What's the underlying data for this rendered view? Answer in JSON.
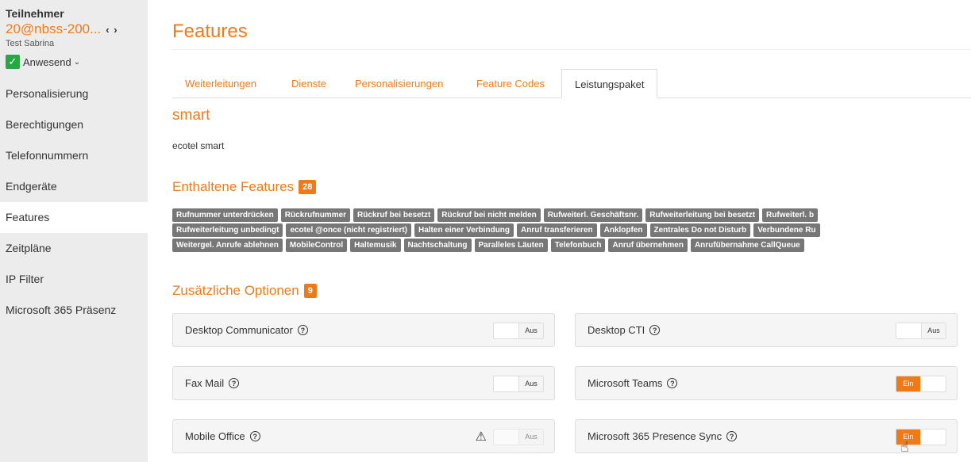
{
  "sidebar": {
    "title": "Teilnehmer",
    "user": "20@nbss-200...",
    "nav_arrows": "‹ ›",
    "subtitle": "Test Sabrina",
    "status": "Anwesend",
    "items": [
      {
        "label": "Personalisierung"
      },
      {
        "label": "Berechtigungen"
      },
      {
        "label": "Telefonnummern"
      },
      {
        "label": "Endgeräte"
      },
      {
        "label": "Features"
      },
      {
        "label": "Zeitpläne"
      },
      {
        "label": "IP Filter"
      },
      {
        "label": "Microsoft 365 Präsenz"
      }
    ]
  },
  "main": {
    "title": "Features",
    "tabs": [
      {
        "label": "Weiterleitungen"
      },
      {
        "label": "Dienste"
      },
      {
        "label": "Personalisierungen"
      },
      {
        "label": "Feature Codes"
      },
      {
        "label": "Leistungspaket"
      }
    ],
    "package_name": "smart",
    "package_desc": "ecotel smart",
    "included_title": "Enthaltene Features",
    "included_count": "28",
    "features_rows": [
      [
        "Rufnummer unterdrücken",
        "Rückrufnummer",
        "Rückruf bei besetzt",
        "Rückruf bei nicht melden",
        "Rufweiterl. Geschäftsnr.",
        "Rufweiterleitung bei besetzt",
        "Rufweiterl. b"
      ],
      [
        "Rufweiterleitung unbedingt",
        "ecotel @once (nicht registriert)",
        "Halten einer Verbindung",
        "Anruf transferieren",
        "Anklopfen",
        "Zentrales Do not Disturb",
        "Verbundene Ru"
      ],
      [
        "Weitergel. Anrufe ablehnen",
        "MobileControl",
        "Haltemusik",
        "Nachtschaltung",
        "Paralleles Läuten",
        "Telefonbuch",
        "Anruf übernehmen",
        "Anrufübernahme CallQueue"
      ]
    ],
    "options_title": "Zusätzliche Optionen",
    "options_count": "9",
    "options": [
      {
        "label": "Desktop Communicator",
        "state": "Aus"
      },
      {
        "label": "Desktop CTI",
        "state": "Aus"
      },
      {
        "label": "Fax Mail",
        "state": "Aus"
      },
      {
        "label": "Microsoft Teams",
        "state": "Ein"
      },
      {
        "label": "Mobile Office",
        "state": "Aus"
      },
      {
        "label": "Microsoft 365 Presence Sync",
        "state": "Ein"
      }
    ],
    "help_glyph": "?",
    "warning_glyph": "⚠"
  },
  "colors": {
    "accent": "#f07a18",
    "badge_gray": "#777777",
    "check_green": "#27a844"
  }
}
